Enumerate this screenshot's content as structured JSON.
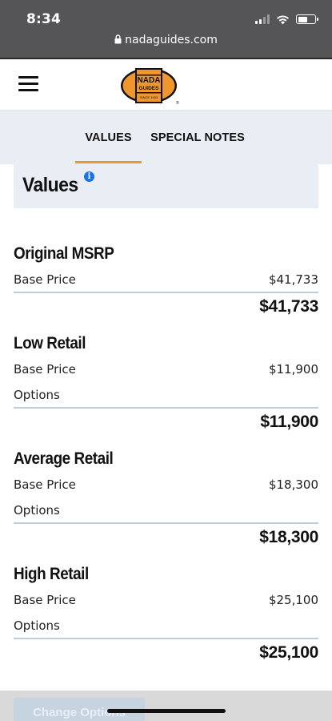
{
  "status_bar": {
    "time": "8:34",
    "url": "nadaguides.com",
    "icons": [
      "signal-icon",
      "wifi-icon",
      "battery-icon"
    ]
  },
  "header": {
    "logo": {
      "line1": "NADA",
      "line2": "GUIDES",
      "line3": "SINCE 1933"
    },
    "menu_icon": "hamburger-icon"
  },
  "tabs": [
    {
      "label": "VALUES",
      "active": true
    },
    {
      "label": "SPECIAL NOTES",
      "active": false
    }
  ],
  "values_heading": {
    "title": "Values",
    "info_icon": "i"
  },
  "sections": [
    {
      "title": "Original MSRP",
      "rows": [
        {
          "label": "Base Price",
          "value": "$41,733"
        }
      ],
      "total": "$41,733"
    },
    {
      "title": "Low Retail",
      "rows": [
        {
          "label": "Base Price",
          "value": "$11,900"
        },
        {
          "label": "Options",
          "value": ""
        }
      ],
      "total": "$11,900"
    },
    {
      "title": "Average Retail",
      "rows": [
        {
          "label": "Base Price",
          "value": "$18,300"
        },
        {
          "label": "Options",
          "value": ""
        }
      ],
      "total": "$18,300"
    },
    {
      "title": "High Retail",
      "rows": [
        {
          "label": "Base Price",
          "value": "$25,100"
        },
        {
          "label": "Options",
          "value": ""
        }
      ],
      "total": "$25,100"
    }
  ],
  "footer": {
    "button_label": "Change Options"
  },
  "colors": {
    "accent": "#f0962e",
    "tab_bg": "#e9eef4",
    "info": "#1a73e8",
    "status_bar": "#555558"
  }
}
